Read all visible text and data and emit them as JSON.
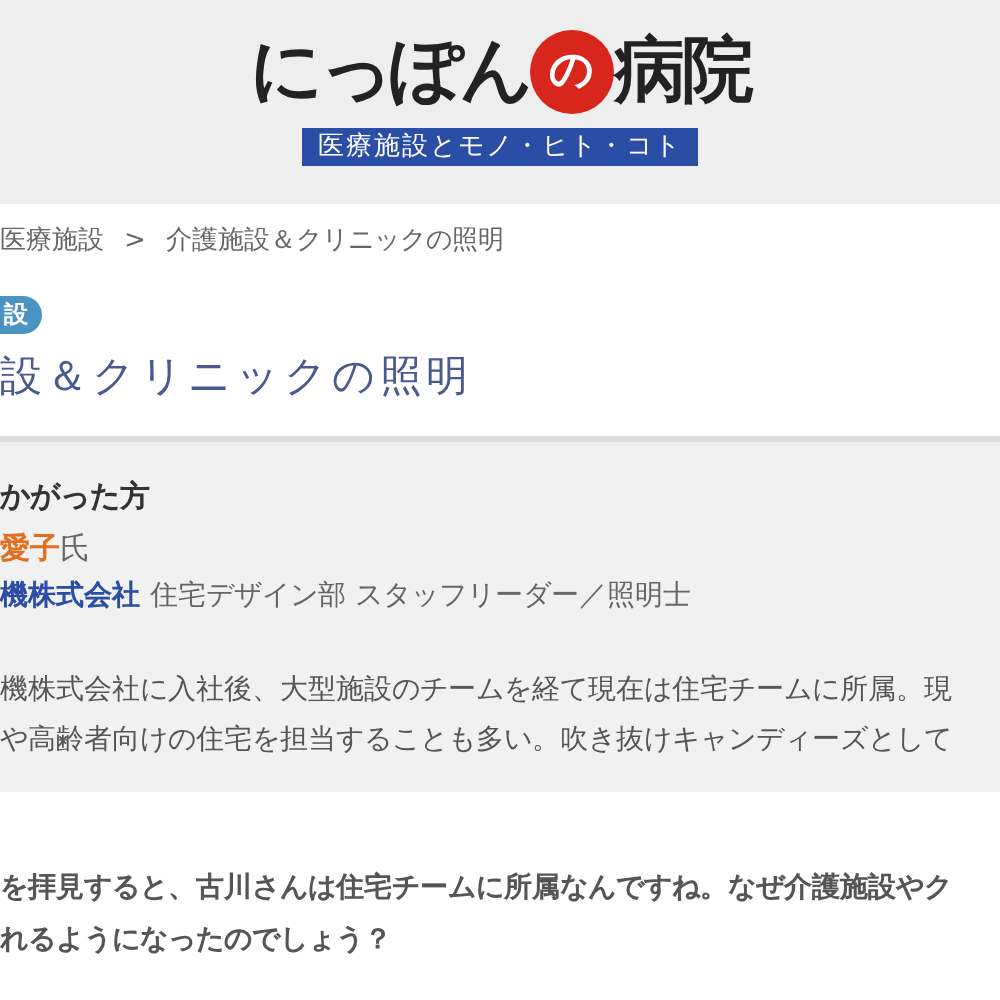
{
  "header": {
    "logo_text": "にっぽん",
    "logo_circle_text": "の",
    "logo_text_end": "病院",
    "tagline": "医療施設とモノ・ヒト・コト"
  },
  "breadcrumb": [
    "医療施設",
    "介護施設＆クリニックの照明"
  ],
  "breadcrumb_separator": ">",
  "category_badge": "設",
  "title": "設＆クリニックの照明",
  "profile": {
    "heading": "かがった方",
    "name": "愛子",
    "honorific": "氏",
    "company": "機株式会社",
    "position": "住宅デザイン部 スタッフリーダー／照明士",
    "bio": [
      "機株式会社に入社後、大型施設のチームを経て現在は住宅チームに所属。現",
      "や高齢者向けの住宅を担当することも多い。吹き抜けキャンディーズとして"
    ]
  },
  "question": [
    "を拝見すると、古川さんは住宅チームに所属なんですね。なぜ介護施設やク",
    "れるようになったのでしょう？"
  ]
}
